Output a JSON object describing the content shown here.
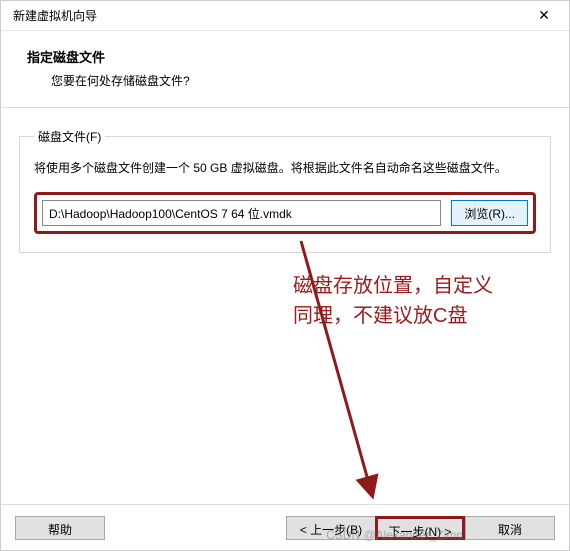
{
  "window": {
    "title": "新建虚拟机向导",
    "close_icon": "✕"
  },
  "header": {
    "title": "指定磁盘文件",
    "subtitle": "您要在何处存储磁盘文件?"
  },
  "group": {
    "legend": "磁盘文件(F)",
    "description": "将使用多个磁盘文件创建一个 50 GB 虚拟磁盘。将根据此文件名自动命名这些磁盘文件。",
    "path_value": "D:\\Hadoop\\Hadoop100\\CentOS 7 64 位.vmdk",
    "browse_label": "浏览(R)..."
  },
  "annotation": {
    "line1": "磁盘存放位置，自定义",
    "line2": "同理，不建议放C盘"
  },
  "footer": {
    "help": "帮助",
    "back": "< 上一步(B)",
    "next": "下一步(N) >",
    "cancel": "取消"
  },
  "watermark": "CSDN @Alexander_Zimo"
}
